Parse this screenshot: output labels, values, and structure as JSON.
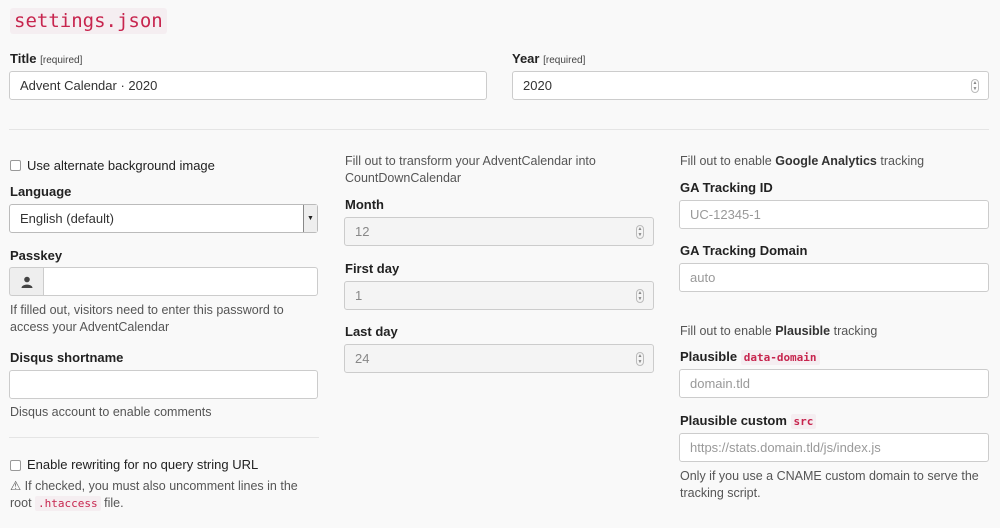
{
  "page_title": "settings.json",
  "title_field": {
    "label": "Title",
    "required": "[required]",
    "value": "Advent Calendar · 2020"
  },
  "year_field": {
    "label": "Year",
    "required": "[required]",
    "value": "2020"
  },
  "col1": {
    "alt_bg_label": "Use alternate background image",
    "language_label": "Language",
    "language_value": "English (default)",
    "passkey_label": "Passkey",
    "passkey_help": "If filled out, visitors need to enter this password to access your AdventCalendar",
    "disqus_label": "Disqus shortname",
    "disqus_help": "Disqus account to enable comments",
    "rewrite_label": "Enable rewriting for no query string URL",
    "rewrite_warn_prefix": "⚠ If checked, you must also uncomment lines in the root",
    "rewrite_warn_code": ".htaccess",
    "rewrite_warn_suffix": "file."
  },
  "col2": {
    "intro": "Fill out to transform your AdventCalendar into CountDownCalendar",
    "month_label": "Month",
    "month_value": "12",
    "first_day_label": "First day",
    "first_day_value": "1",
    "last_day_label": "Last day",
    "last_day_value": "24"
  },
  "col3": {
    "ga_intro_prefix": "Fill out to enable",
    "ga_intro_strong": "Google Analytics",
    "ga_intro_suffix": "tracking",
    "ga_id_label": "GA Tracking ID",
    "ga_id_placeholder": "UC-12345-1",
    "ga_domain_label": "GA Tracking Domain",
    "ga_domain_placeholder": "auto",
    "pl_intro_prefix": "Fill out to enable",
    "pl_intro_strong": "Plausible",
    "pl_intro_suffix": "tracking",
    "pl_domain_label": "Plausible",
    "pl_domain_code": "data-domain",
    "pl_domain_placeholder": "domain.tld",
    "pl_src_label": "Plausible custom",
    "pl_src_code": "src",
    "pl_src_placeholder": "https://stats.domain.tld/js/index.js",
    "pl_src_help": "Only if you use a CNAME custom domain to serve the tracking script."
  },
  "icons": {
    "passkey_addon": "user-icon",
    "spinner": "number-spinner-icon",
    "select_arrow": "chevron-down-icon",
    "warning": "warning-icon"
  },
  "colors": {
    "background": "#f9f9f9",
    "code_accent": "#c7254e",
    "code_bg": "#f5eef1"
  }
}
